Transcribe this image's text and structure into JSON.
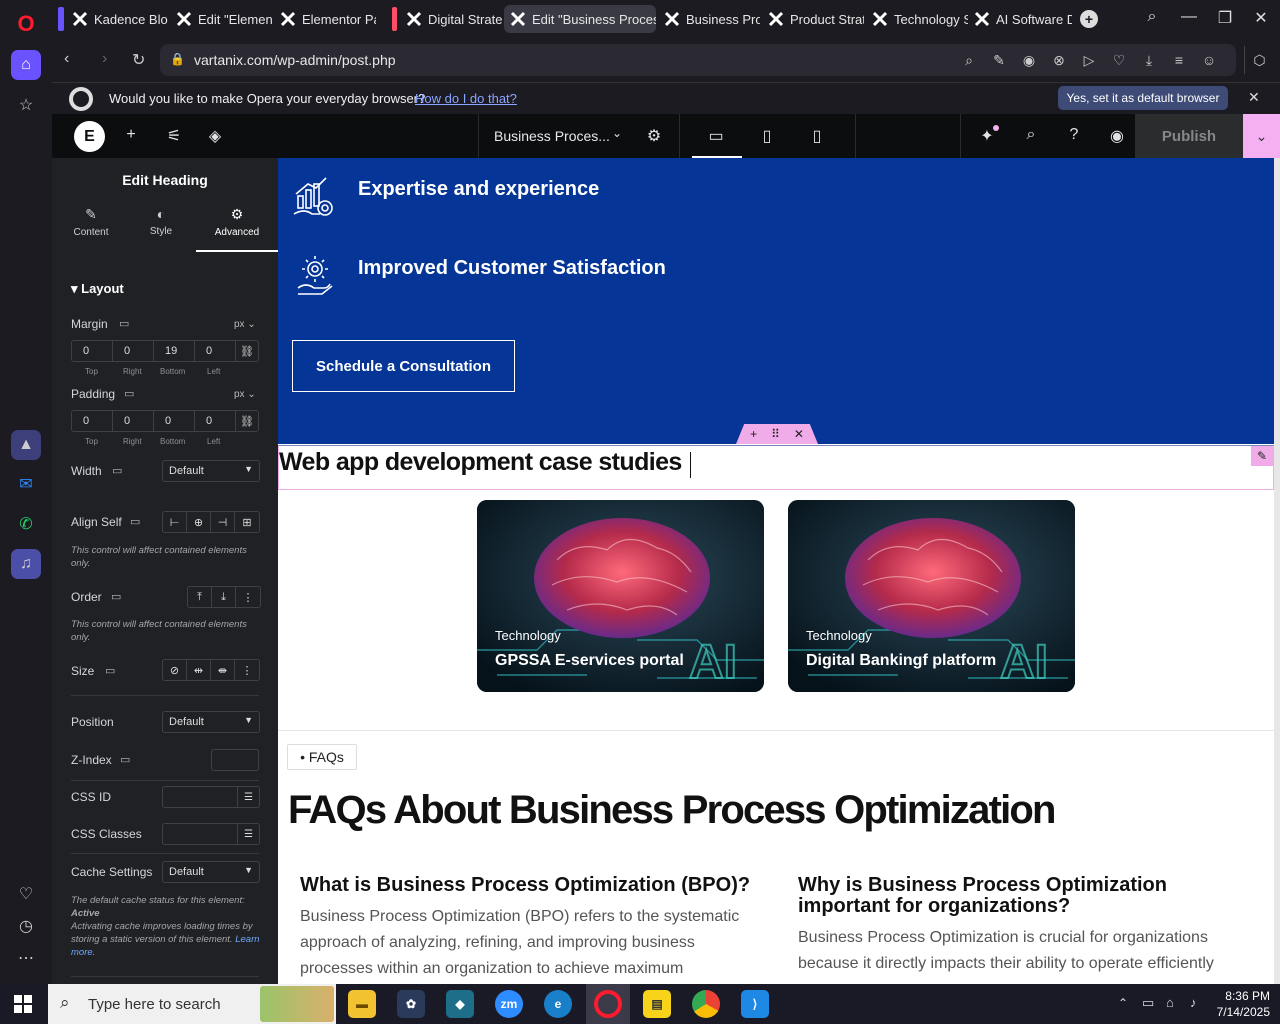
{
  "browser": {
    "tabs": [
      {
        "label": "Kadence Block"
      },
      {
        "label": "Edit \"Elemento"
      },
      {
        "label": "Elementor Pag"
      },
      {
        "label": "Digital Strateg"
      },
      {
        "label": "Edit \"Business Process O"
      },
      {
        "label": "Business Proce"
      },
      {
        "label": "Product Strate"
      },
      {
        "label": "Technology St"
      },
      {
        "label": "AI Software D"
      }
    ],
    "url": "vartanix.com/wp-admin/post.php",
    "notification": {
      "text": "Would you like to make Opera your everyday browser?",
      "link": "How do I do that?",
      "button": "Yes, set it as default browser"
    }
  },
  "editor": {
    "doc_title": "Business Proces...",
    "publish_label": "Publish",
    "panel": {
      "title": "Edit Heading",
      "tabs": [
        "Content",
        "Style",
        "Advanced"
      ],
      "section": "Layout",
      "margin": {
        "label": "Margin",
        "unit": "px",
        "values": [
          "0",
          "0",
          "19",
          "0"
        ]
      },
      "padding": {
        "label": "Padding",
        "unit": "px",
        "values": [
          "0",
          "0",
          "0",
          "0"
        ]
      },
      "sides": [
        "Top",
        "Right",
        "Bottom",
        "Left"
      ],
      "width": {
        "label": "Width",
        "value": "Default"
      },
      "align_self": {
        "label": "Align Self"
      },
      "note": "This control will affect contained elements only.",
      "order": {
        "label": "Order"
      },
      "size": {
        "label": "Size"
      },
      "position": {
        "label": "Position",
        "value": "Default"
      },
      "zindex": {
        "label": "Z-Index"
      },
      "css_id": {
        "label": "CSS ID"
      },
      "css_classes": {
        "label": "CSS Classes"
      },
      "cache": {
        "label": "Cache Settings",
        "value": "Default"
      },
      "cache_note_1": "The default cache status for this element:",
      "cache_note_status": "Active",
      "cache_note_2": "Activating cache improves loading times by storing a static version of this element.",
      "learn_more": "Learn more."
    }
  },
  "page": {
    "features": [
      "Expertise and experience",
      "Improved Customer Satisfaction"
    ],
    "cta": "Schedule a Consultation",
    "heading": "Web app development case studies",
    "cases": [
      {
        "category": "Technology",
        "title": "GPSSA E-services portal"
      },
      {
        "category": "Technology",
        "title": "Digital Bankingf platform"
      }
    ],
    "faq_pill": "• FAQs",
    "faq_heading": "FAQs About Business Process Optimization",
    "faqs": [
      {
        "q": "What is Business Process Optimization (BPO)?",
        "a": "Business Process Optimization (BPO) refers to the systematic approach of analyzing, refining, and improving business processes within an organization to achieve maximum"
      },
      {
        "q": "Why is Business Process Optimization important for organizations?",
        "a": "Business Process Optimization is crucial for organizations because it directly impacts their ability to operate efficiently"
      }
    ]
  },
  "taskbar": {
    "search_placeholder": "Type here to search",
    "time": "8:36 PM",
    "date": "7/14/2025"
  },
  "colors": {
    "hero_bg": "#053597",
    "selection": "#f0abe9",
    "panel_bg": "#1f2124"
  }
}
